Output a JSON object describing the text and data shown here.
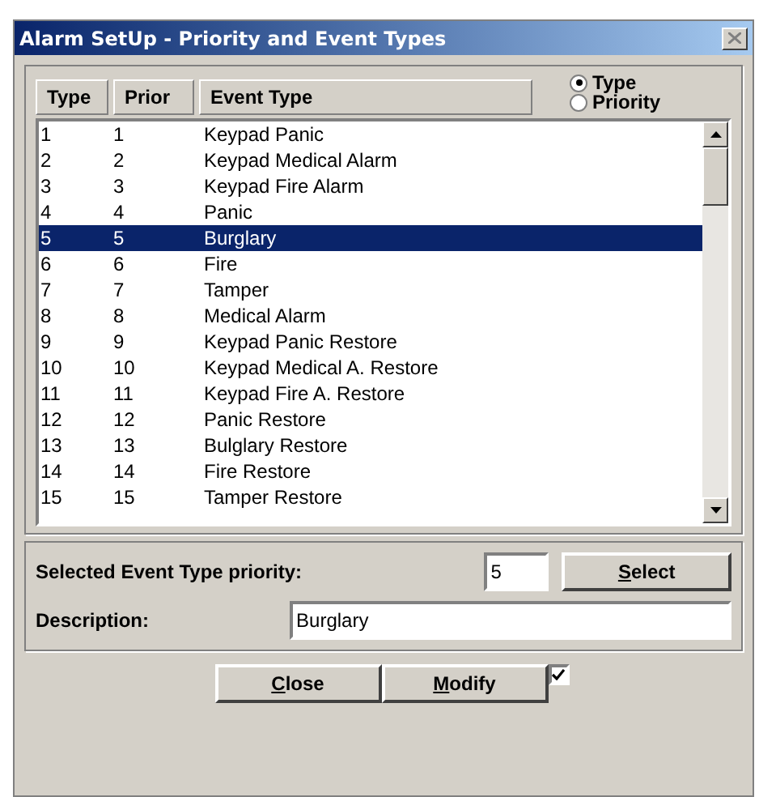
{
  "window": {
    "title": "Alarm SetUp - Priority and Event Types"
  },
  "columns": [
    "Type",
    "Prior",
    "Event Type"
  ],
  "sort_options": [
    {
      "label": "Type",
      "selected": true
    },
    {
      "label": "Priority",
      "selected": false
    }
  ],
  "rows": [
    {
      "type": "1",
      "prior": "1",
      "event": "Keypad Panic",
      "selected": false
    },
    {
      "type": "2",
      "prior": "2",
      "event": "Keypad Medical Alarm",
      "selected": false
    },
    {
      "type": "3",
      "prior": "3",
      "event": "Keypad Fire Alarm",
      "selected": false
    },
    {
      "type": "4",
      "prior": "4",
      "event": "Panic",
      "selected": false
    },
    {
      "type": "5",
      "prior": "5",
      "event": "Burglary",
      "selected": true
    },
    {
      "type": "6",
      "prior": "6",
      "event": "Fire",
      "selected": false
    },
    {
      "type": "7",
      "prior": "7",
      "event": "Tamper",
      "selected": false
    },
    {
      "type": "8",
      "prior": "8",
      "event": "Medical Alarm",
      "selected": false
    },
    {
      "type": "9",
      "prior": "9",
      "event": "Keypad Panic Restore",
      "selected": false
    },
    {
      "type": "10",
      "prior": "10",
      "event": "Keypad Medical A. Restore",
      "selected": false
    },
    {
      "type": "11",
      "prior": "11",
      "event": "Keypad Fire A. Restore",
      "selected": false
    },
    {
      "type": "12",
      "prior": "12",
      "event": "Panic Restore",
      "selected": false
    },
    {
      "type": "13",
      "prior": "13",
      "event": "Bulglary Restore",
      "selected": false
    },
    {
      "type": "14",
      "prior": "14",
      "event": "Fire Restore",
      "selected": false
    },
    {
      "type": "15",
      "prior": "15",
      "event": "Tamper Restore",
      "selected": false
    }
  ],
  "priority": {
    "label": "Selected Event Type priority:",
    "value": "5",
    "button": "Select"
  },
  "description": {
    "label": "Description:",
    "value": "Burglary"
  },
  "buttons": [
    "Close",
    "Modify"
  ],
  "modify_check": {
    "checked": true
  }
}
